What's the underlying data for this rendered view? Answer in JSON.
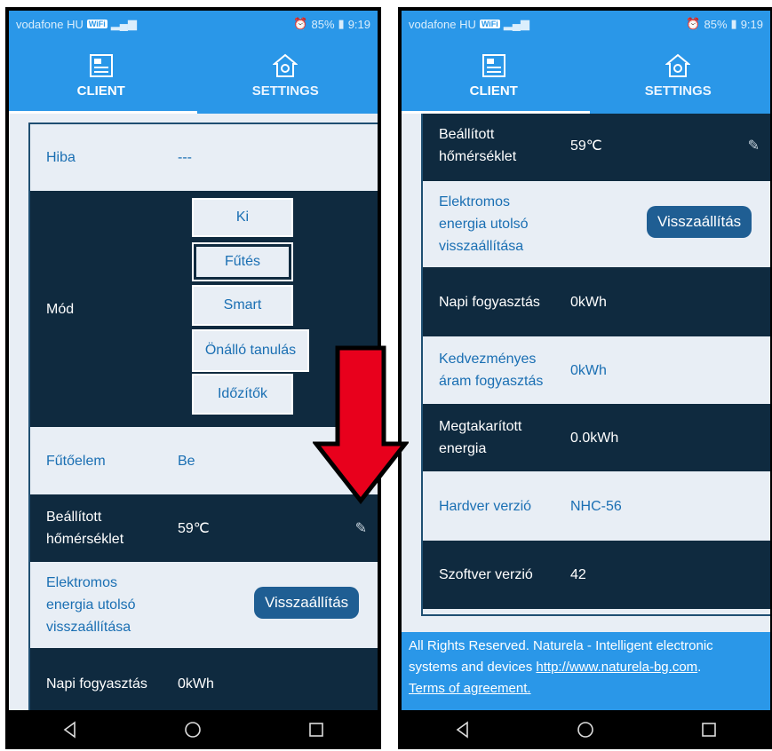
{
  "status": {
    "carrier": "vodafone HU",
    "wifi_badge": "WiFi",
    "battery": "85%",
    "time": "9:19"
  },
  "tabs": [
    {
      "label": "CLIENT"
    },
    {
      "label": "SETTINGS"
    }
  ],
  "left": {
    "rows": {
      "hiba": {
        "label": "Hiba",
        "value": "---"
      },
      "mod": {
        "label": "Mód",
        "options": [
          "Ki",
          "Fűtés",
          "Smart",
          "Önálló tanulás",
          "Időzítők"
        ],
        "selected": "Fűtés"
      },
      "futoelem": {
        "label": "Fűtőelem",
        "value": "Be"
      },
      "homerseklet": {
        "label1": "Beállított",
        "label2": "hőmérséklet",
        "value": "59℃"
      },
      "elektromos": {
        "label1": "Elektromos",
        "label2": "energia utolsó",
        "label3": "visszaállítása",
        "button": "Visszaállítás"
      },
      "napi": {
        "label": "Napi fogyasztás",
        "value": "0kWh"
      }
    }
  },
  "right": {
    "rows": {
      "homerseklet": {
        "label1": "Beállított",
        "label2": "hőmérséklet",
        "value": "59℃"
      },
      "elektromos": {
        "label1": "Elektromos",
        "label2": "energia utolsó",
        "label3": "visszaállítása",
        "button": "Visszaállítás"
      },
      "napi": {
        "label": "Napi fogyasztás",
        "value": "0kWh"
      },
      "kedvezmenyes": {
        "label1": "Kedvezményes",
        "label2": "áram fogyasztás",
        "value": "0kWh"
      },
      "megtakaritott": {
        "label1": "Megtakarított",
        "label2": "energia",
        "value": "0.0kWh"
      },
      "hardver": {
        "label": "Hardver verzió",
        "value": "NHC-56"
      },
      "szoftver": {
        "label": "Szoftver verzió",
        "value": "42"
      }
    },
    "footer": {
      "text1": "All Rights Reserved. Naturela - Intelligent electronic systems and devices ",
      "link": "http://www.naturela-bg.com",
      "text2": ".",
      "terms": "Terms of agreement."
    }
  },
  "colors": {
    "primary": "#2a97e8",
    "dark_row": "#0f2a3f",
    "light_row": "#e8eef5",
    "accent_text": "#1a6fb3",
    "button": "#1f5e93",
    "arrow": "#e8001c"
  },
  "icons": [
    "client-icon",
    "settings-icon",
    "pencil-icon",
    "back-icon",
    "home-icon",
    "recents-icon",
    "down-arrow-icon"
  ]
}
